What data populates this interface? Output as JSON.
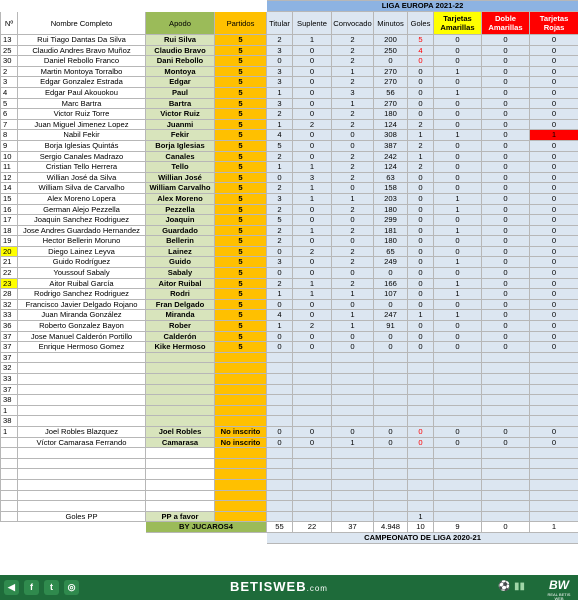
{
  "header": {
    "col_num": "Nº",
    "col_nombre": "Nombre Completo",
    "col_apodo": "Apodo",
    "col_partidos": "Partidos",
    "competition": "LIGA EUROPA 2021-22",
    "stat_cols": [
      "Titular",
      "Suplente",
      "Convocado",
      "Minutos",
      "Goles",
      "Tarjetas Amarillas",
      "Doble Amarillas",
      "Tarjetas Rojas"
    ]
  },
  "players": [
    {
      "num": "13",
      "nombre": "Rui Tiago Dantas Da Silva",
      "apodo": "Rui Silva",
      "partidos": "5",
      "stats": [
        "2",
        "1",
        "2",
        "200",
        "5",
        "0",
        "0",
        "0"
      ]
    },
    {
      "num": "25",
      "nombre": "Claudio Andres Bravo Muñoz",
      "apodo": "Claudio Bravo",
      "partidos": "5",
      "stats": [
        "3",
        "0",
        "2",
        "250",
        "4",
        "0",
        "0",
        "0"
      ]
    },
    {
      "num": "30",
      "nombre": "Daniel Rebollo Franco",
      "apodo": "Dani  Rebollo",
      "partidos": "5",
      "stats": [
        "0",
        "0",
        "2",
        "0",
        "0",
        "0",
        "0",
        "0"
      ]
    },
    {
      "num": "2",
      "nombre": "Martin Montoya Torralbo",
      "apodo": "Montoya",
      "partidos": "5",
      "stats": [
        "3",
        "0",
        "1",
        "270",
        "0",
        "1",
        "0",
        "0"
      ]
    },
    {
      "num": "3",
      "nombre": "Edgar Gonzalez Estrada",
      "apodo": "Edgar",
      "partidos": "5",
      "stats": [
        "3",
        "0",
        "2",
        "270",
        "0",
        "0",
        "0",
        "0"
      ]
    },
    {
      "num": "4",
      "nombre": "Edgar Paul Akouokou",
      "apodo": "Paul",
      "partidos": "5",
      "stats": [
        "1",
        "0",
        "3",
        "56",
        "0",
        "1",
        "0",
        "0"
      ]
    },
    {
      "num": "5",
      "nombre": "Marc Bartra",
      "apodo": "Bartra",
      "partidos": "5",
      "stats": [
        "3",
        "0",
        "1",
        "270",
        "0",
        "0",
        "0",
        "0"
      ]
    },
    {
      "num": "6",
      "nombre": "Victor Ruiz Torre",
      "apodo": "Victor Ruiz",
      "partidos": "5",
      "stats": [
        "2",
        "0",
        "2",
        "180",
        "0",
        "0",
        "0",
        "0"
      ]
    },
    {
      "num": "7",
      "nombre": "Juan Miguel Jimenez Lopez",
      "apodo": "Juanmi",
      "partidos": "5",
      "stats": [
        "1",
        "2",
        "2",
        "124",
        "2",
        "0",
        "0",
        "0"
      ]
    },
    {
      "num": "8",
      "nombre": "Nabil Fekir",
      "apodo": "Fekir",
      "partidos": "5",
      "stats": [
        "4",
        "0",
        "0",
        "308",
        "1",
        "1",
        "0",
        "1"
      ]
    },
    {
      "num": "9",
      "nombre": "Borja Iglesias Quintás",
      "apodo": "Borja Iglesias",
      "partidos": "5",
      "stats": [
        "5",
        "0",
        "0",
        "387",
        "2",
        "0",
        "0",
        "0"
      ]
    },
    {
      "num": "10",
      "nombre": "Sergio Canales Madrazo",
      "apodo": "Canales",
      "partidos": "5",
      "stats": [
        "2",
        "0",
        "2",
        "242",
        "1",
        "0",
        "0",
        "0"
      ]
    },
    {
      "num": "11",
      "nombre": "Cristian Tello Herrera",
      "apodo": "Tello",
      "partidos": "5",
      "stats": [
        "1",
        "1",
        "2",
        "124",
        "2",
        "0",
        "0",
        "0"
      ]
    },
    {
      "num": "12",
      "nombre": "Willian José da Silva",
      "apodo": "Willian José",
      "partidos": "5",
      "stats": [
        "0",
        "3",
        "2",
        "63",
        "0",
        "0",
        "0",
        "0"
      ]
    },
    {
      "num": "14",
      "nombre": "William Silva de Carvalho",
      "apodo": "William Carvalho",
      "partidos": "5",
      "stats": [
        "2",
        "1",
        "0",
        "158",
        "0",
        "0",
        "0",
        "0"
      ]
    },
    {
      "num": "15",
      "nombre": "Alex Moreno Lopera",
      "apodo": "Alex Moreno",
      "partidos": "5",
      "stats": [
        "3",
        "1",
        "1",
        "203",
        "0",
        "1",
        "0",
        "0"
      ]
    },
    {
      "num": "16",
      "nombre": "German Alejo Pezzella",
      "apodo": "Pezzella",
      "partidos": "5",
      "stats": [
        "2",
        "0",
        "2",
        "180",
        "0",
        "1",
        "0",
        "0"
      ]
    },
    {
      "num": "17",
      "nombre": "Joaquin Sanchez Rodriguez",
      "apodo": "Joaquin",
      "partidos": "5",
      "stats": [
        "5",
        "0",
        "0",
        "299",
        "0",
        "0",
        "0",
        "0"
      ]
    },
    {
      "num": "18",
      "nombre": "Jose Andres Guardado Hernandez",
      "apodo": "Guardado",
      "partidos": "5",
      "stats": [
        "2",
        "1",
        "2",
        "181",
        "0",
        "1",
        "0",
        "0"
      ]
    },
    {
      "num": "19",
      "nombre": "Hector Bellerin Moruno",
      "apodo": "Bellerin",
      "partidos": "5",
      "stats": [
        "2",
        "0",
        "0",
        "180",
        "0",
        "0",
        "0",
        "0"
      ]
    },
    {
      "num": "20",
      "nombre": "Diego Lainez Leyva",
      "apodo": "Lainez",
      "partidos": "5",
      "stats": [
        "0",
        "2",
        "2",
        "65",
        "0",
        "0",
        "0",
        "0"
      ]
    },
    {
      "num": "21",
      "nombre": "Guido Rodríguez",
      "apodo": "Guido",
      "partidos": "5",
      "stats": [
        "3",
        "0",
        "2",
        "249",
        "0",
        "1",
        "0",
        "0"
      ]
    },
    {
      "num": "22",
      "nombre": "Youssouf Sabaly",
      "apodo": "Sabaly",
      "partidos": "5",
      "stats": [
        "0",
        "0",
        "0",
        "0",
        "0",
        "0",
        "0",
        "0"
      ]
    },
    {
      "num": "23",
      "nombre": "Aitor Ruibal García",
      "apodo": "Aitor Ruibal",
      "partidos": "5",
      "stats": [
        "2",
        "1",
        "2",
        "166",
        "0",
        "1",
        "0",
        "0"
      ]
    },
    {
      "num": "28",
      "nombre": "Rodrigo Sanchez Rodriguez",
      "apodo": "Rodri",
      "partidos": "5",
      "stats": [
        "1",
        "1",
        "1",
        "107",
        "0",
        "1",
        "0",
        "0"
      ]
    },
    {
      "num": "32",
      "nombre": "Francisco Javier Delgado Rojano",
      "apodo": "Fran Delgado",
      "partidos": "5",
      "stats": [
        "0",
        "0",
        "0",
        "0",
        "0",
        "0",
        "0",
        "0"
      ]
    },
    {
      "num": "33",
      "nombre": "Juan Miranda González",
      "apodo": "Miranda",
      "partidos": "5",
      "stats": [
        "4",
        "0",
        "1",
        "247",
        "1",
        "1",
        "0",
        "0"
      ]
    },
    {
      "num": "36",
      "nombre": "Roberto Gonzalez Bayon",
      "apodo": "Rober",
      "partidos": "5",
      "stats": [
        "1",
        "2",
        "1",
        "91",
        "0",
        "0",
        "0",
        "0"
      ]
    },
    {
      "num": "37",
      "nombre": "Jose Manuel Calderón Portillo",
      "apodo": "Calderón",
      "partidos": "5",
      "stats": [
        "0",
        "0",
        "0",
        "0",
        "0",
        "0",
        "0",
        "0"
      ]
    },
    {
      "num": "37",
      "nombre": "Enrique Hermoso Gomez",
      "apodo": "Kike Hermoso",
      "partidos": "5",
      "stats": [
        "0",
        "0",
        "0",
        "0",
        "0",
        "0",
        "0",
        "0"
      ]
    }
  ],
  "empty_nums": [
    "37",
    "32",
    "33",
    "37",
    "38",
    "1",
    "38"
  ],
  "others": [
    {
      "num": "1",
      "nombre": "Joel Robles Blazquez",
      "apodo": "Joel Robles",
      "partidos": "No inscrito",
      "stats": [
        "0",
        "0",
        "0",
        "0",
        "0",
        "0",
        "0",
        "0"
      ]
    },
    {
      "num": "",
      "nombre": "Víctor Camarasa Ferrando",
      "apodo": "Camarasa",
      "partidos": "No inscrito",
      "stats": [
        "0",
        "0",
        "1",
        "0",
        "0",
        "0",
        "0",
        "0"
      ]
    }
  ],
  "goles_pp": {
    "label": "Goles PP",
    "apodo": "PP a favor",
    "goles": "1"
  },
  "totals": {
    "label": "BY JUCAROS4",
    "titular": "55",
    "suplente": "22",
    "convocado": "37",
    "minutos": "4.948",
    "goles": "10",
    "amarillas": "9",
    "doble": "0",
    "rojas": "1"
  },
  "campeonato": "CAMPEONATO  DE LIGA 2020-21",
  "footer": {
    "brand": "BETISWEB",
    "domain": ".com",
    "logo": "BW",
    "logo_sub": "REAL BETIS WEB"
  },
  "colors": {
    "apodo_bg": "#d8e4bc",
    "partidos_bg": "#ffc000",
    "stat_bg": "#dce6f1",
    "red": "#ff0000",
    "yellow": "#ffff00",
    "footer_bg": "#1e6b3a"
  }
}
